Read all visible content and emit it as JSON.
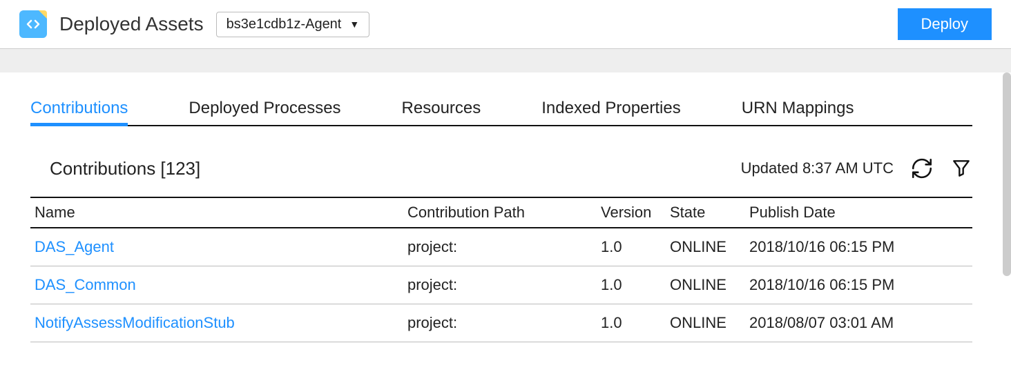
{
  "header": {
    "title": "Deployed Assets",
    "agent_selected": "bs3e1cdb1z-Agent",
    "deploy_label": "Deploy"
  },
  "tabs": [
    {
      "label": "Contributions",
      "active": true
    },
    {
      "label": "Deployed Processes",
      "active": false
    },
    {
      "label": "Resources",
      "active": false
    },
    {
      "label": "Indexed Properties",
      "active": false
    },
    {
      "label": "URN Mappings",
      "active": false
    }
  ],
  "section": {
    "title": "Contributions [123]",
    "updated_label": "Updated 8:37 AM UTC"
  },
  "table": {
    "columns": {
      "name": "Name",
      "path": "Contribution Path",
      "version": "Version",
      "state": "State",
      "date": "Publish Date"
    },
    "rows": [
      {
        "name": "DAS_Agent",
        "path": "project:",
        "version": "1.0",
        "state": "ONLINE",
        "date": "2018/10/16 06:15 PM"
      },
      {
        "name": "DAS_Common",
        "path": "project:",
        "version": "1.0",
        "state": "ONLINE",
        "date": "2018/10/16 06:15 PM"
      },
      {
        "name": "NotifyAssessModificationStub",
        "path": "project:",
        "version": "1.0",
        "state": "ONLINE",
        "date": "2018/08/07 03:01 AM"
      }
    ]
  }
}
